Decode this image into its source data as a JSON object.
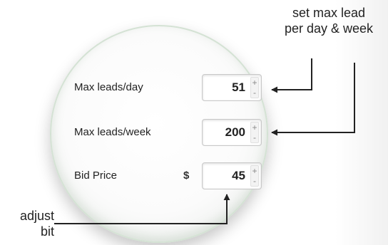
{
  "form": {
    "rows": [
      {
        "label": "Max leads/day",
        "value": "51"
      },
      {
        "label": "Max leads/week",
        "value": "200"
      },
      {
        "label": "Bid Price",
        "currency": "$",
        "value": "45"
      }
    ],
    "stepper": {
      "increment": "+",
      "decrement": "-"
    }
  },
  "annotations": {
    "top": [
      "set max lead",
      "per day & week"
    ],
    "bottom": [
      "adjust",
      "bit"
    ]
  }
}
